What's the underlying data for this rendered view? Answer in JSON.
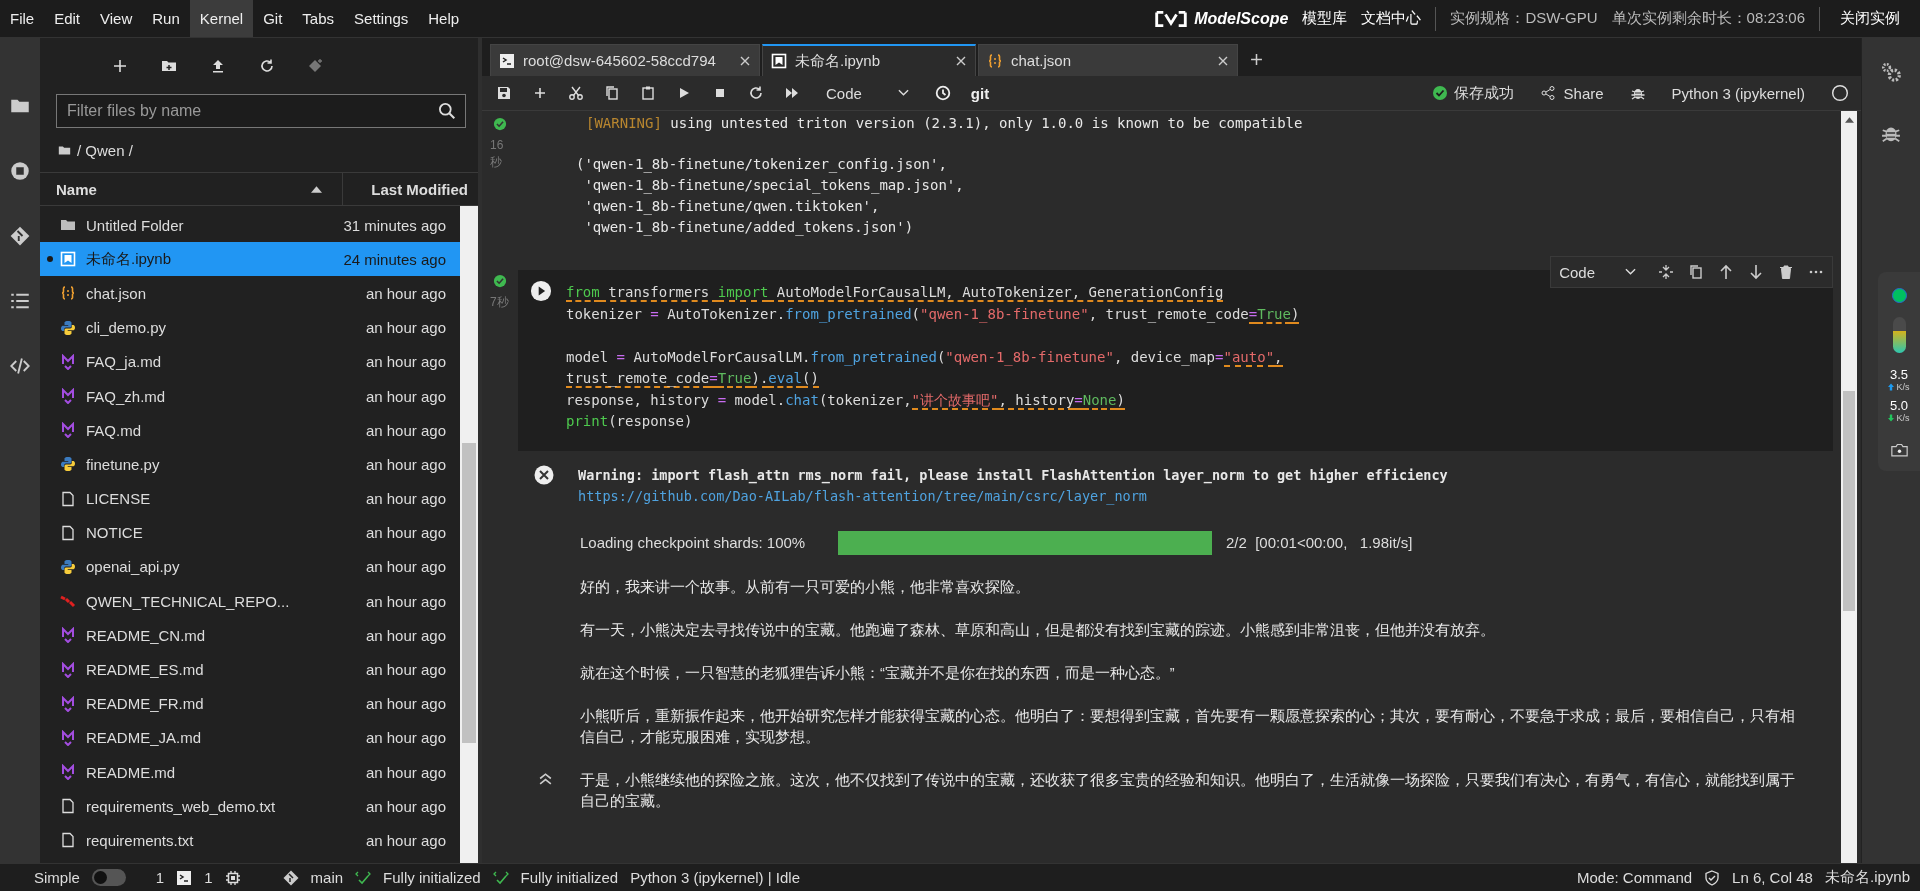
{
  "menu": [
    {
      "label": "File",
      "selected": false
    },
    {
      "label": "Edit",
      "selected": false
    },
    {
      "label": "View",
      "selected": false
    },
    {
      "label": "Run",
      "selected": false
    },
    {
      "label": "Kernel",
      "selected": true
    },
    {
      "label": "Git",
      "selected": false
    },
    {
      "label": "Tabs",
      "selected": false
    },
    {
      "label": "Settings",
      "selected": false
    },
    {
      "label": "Help",
      "selected": false
    }
  ],
  "header": {
    "logo": "ModelScope",
    "links": [
      "模型库",
      "文档中心"
    ],
    "spec": "实例规格：DSW-GPU",
    "remaining": "单次实例剩余时长：08:23:06",
    "close_button": "关闭实例"
  },
  "file_browser": {
    "filter_placeholder": "Filter files by name",
    "breadcrumb": "/ Qwen /",
    "columns": [
      "Name",
      "Last Modified"
    ],
    "files": [
      {
        "kind": "folder",
        "name": "Untitled Folder",
        "modified": "31 minutes ago",
        "selected": false,
        "running": false
      },
      {
        "kind": "notebook",
        "name": "未命名.ipynb",
        "modified": "24 minutes ago",
        "selected": true,
        "running": true
      },
      {
        "kind": "json",
        "name": "chat.json",
        "modified": "an hour ago",
        "selected": false,
        "running": false
      },
      {
        "kind": "python",
        "name": "cli_demo.py",
        "modified": "an hour ago",
        "selected": false,
        "running": false
      },
      {
        "kind": "markdown",
        "name": "FAQ_ja.md",
        "modified": "an hour ago",
        "selected": false,
        "running": false
      },
      {
        "kind": "markdown",
        "name": "FAQ_zh.md",
        "modified": "an hour ago",
        "selected": false,
        "running": false
      },
      {
        "kind": "markdown",
        "name": "FAQ.md",
        "modified": "an hour ago",
        "selected": false,
        "running": false
      },
      {
        "kind": "python",
        "name": "finetune.py",
        "modified": "an hour ago",
        "selected": false,
        "running": false
      },
      {
        "kind": "file",
        "name": "LICENSE",
        "modified": "an hour ago",
        "selected": false,
        "running": false
      },
      {
        "kind": "file",
        "name": "NOTICE",
        "modified": "an hour ago",
        "selected": false,
        "running": false
      },
      {
        "kind": "python",
        "name": "openai_api.py",
        "modified": "an hour ago",
        "selected": false,
        "running": false
      },
      {
        "kind": "pdf",
        "name": "QWEN_TECHNICAL_REPO...",
        "modified": "an hour ago",
        "selected": false,
        "running": false
      },
      {
        "kind": "markdown",
        "name": "README_CN.md",
        "modified": "an hour ago",
        "selected": false,
        "running": false
      },
      {
        "kind": "markdown",
        "name": "README_ES.md",
        "modified": "an hour ago",
        "selected": false,
        "running": false
      },
      {
        "kind": "markdown",
        "name": "README_FR.md",
        "modified": "an hour ago",
        "selected": false,
        "running": false
      },
      {
        "kind": "markdown",
        "name": "README_JA.md",
        "modified": "an hour ago",
        "selected": false,
        "running": false
      },
      {
        "kind": "markdown",
        "name": "README.md",
        "modified": "an hour ago",
        "selected": false,
        "running": false
      },
      {
        "kind": "file",
        "name": "requirements_web_demo.txt",
        "modified": "an hour ago",
        "selected": false,
        "running": false
      },
      {
        "kind": "file",
        "name": "requirements.txt",
        "modified": "an hour ago",
        "selected": false,
        "running": false
      }
    ]
  },
  "tabs": [
    {
      "kind": "terminal",
      "label": "root@dsw-645602-58ccd794",
      "selected": false
    },
    {
      "kind": "notebook",
      "label": "未命名.ipynb",
      "selected": true
    },
    {
      "kind": "json",
      "label": "chat.json",
      "selected": false
    }
  ],
  "toolbar": {
    "cell_type": "Code",
    "git": "git",
    "save_status": "保存成功",
    "share": "Share",
    "kernel": "Python 3 (ipykernel)"
  },
  "cell_1": {
    "exec_time": "16秒",
    "warning_tag": "[WARNING]",
    "warning_text": "using untested triton version (2.3.1), only 1.0.0 is known to be compatible",
    "result": [
      "('qwen-1_8b-finetune/tokenizer_config.json',",
      " 'qwen-1_8b-finetune/special_tokens_map.json',",
      " 'qwen-1_8b-finetune/qwen.tiktoken',",
      " 'qwen-1_8b-finetune/added_tokens.json')"
    ]
  },
  "cell_2": {
    "exec_time": "7秒",
    "cell_type": "Code",
    "lines": [
      {
        "kind": "code",
        "tokens": [
          {
            "kind": "kw",
            "text": "from",
            "warn": true
          },
          {
            "kind": "p",
            "text": " transformers ",
            "warn": true
          },
          {
            "kind": "kw",
            "text": "import",
            "warn": true
          },
          {
            "kind": "p",
            "text": " AutoModelForCausalLM, AutoTokenizer, GenerationConfig",
            "warn": true
          }
        ]
      },
      {
        "kind": "code",
        "tokens": [
          {
            "kind": "p",
            "text": "tokenizer ",
            "warn": false
          },
          {
            "kind": "op",
            "text": "=",
            "warn": false
          },
          {
            "kind": "p",
            "text": " AutoTokenizer.",
            "warn": false
          },
          {
            "kind": "fn",
            "text": "from_pretrained",
            "warn": false
          },
          {
            "kind": "p",
            "text": "(",
            "warn": false
          },
          {
            "kind": "str",
            "text": "\"qwen-1_8b-finetune\"",
            "warn": false
          },
          {
            "kind": "p",
            "text": ", trust_remote_code",
            "warn": false
          },
          {
            "kind": "op",
            "text": "=",
            "warn": true
          },
          {
            "kind": "const",
            "text": "True",
            "warn": true
          },
          {
            "kind": "p",
            "text": ")",
            "warn": true
          }
        ]
      },
      {
        "kind": "blank"
      },
      {
        "kind": "code",
        "tokens": [
          {
            "kind": "p",
            "text": "model ",
            "warn": false
          },
          {
            "kind": "op",
            "text": "=",
            "warn": false
          },
          {
            "kind": "p",
            "text": " AutoModelForCausalLM.",
            "warn": false
          },
          {
            "kind": "fn",
            "text": "from_pretrained",
            "warn": false
          },
          {
            "kind": "p",
            "text": "(",
            "warn": false
          },
          {
            "kind": "str",
            "text": "\"qwen-1_8b-finetune\"",
            "warn": false
          },
          {
            "kind": "p",
            "text": ", device_map",
            "warn": false
          },
          {
            "kind": "op",
            "text": "=",
            "warn": false
          },
          {
            "kind": "str",
            "text": "\"auto\"",
            "warn": true
          },
          {
            "kind": "p",
            "text": ",",
            "warn": true
          }
        ]
      },
      {
        "kind": "code",
        "tokens": [
          {
            "kind": "p",
            "text": "trust_remote_code",
            "warn": true
          },
          {
            "kind": "op",
            "text": "=",
            "warn": true
          },
          {
            "kind": "const",
            "text": "True",
            "warn": true
          },
          {
            "kind": "p",
            "text": ").",
            "warn": true
          },
          {
            "kind": "fn",
            "text": "eval",
            "warn": true
          },
          {
            "kind": "p",
            "text": "()",
            "warn": true
          }
        ]
      },
      {
        "kind": "code",
        "tokens": [
          {
            "kind": "p",
            "text": "response, history ",
            "warn": false
          },
          {
            "kind": "op",
            "text": "=",
            "warn": false
          },
          {
            "kind": "p",
            "text": " model.",
            "warn": false
          },
          {
            "kind": "fn",
            "text": "chat",
            "warn": false
          },
          {
            "kind": "p",
            "text": "(tokenizer,",
            "warn": false
          },
          {
            "kind": "str",
            "text": "\"讲个故事吧\"",
            "warn": true
          },
          {
            "kind": "p",
            "text": ", history",
            "warn": true
          },
          {
            "kind": "op",
            "text": "=",
            "warn": true
          },
          {
            "kind": "const",
            "text": "None",
            "warn": true
          },
          {
            "kind": "p",
            "text": ")",
            "warn": true
          }
        ]
      },
      {
        "kind": "code",
        "tokens": [
          {
            "kind": "builtin",
            "text": "print",
            "warn": false
          },
          {
            "kind": "p",
            "text": "(response)",
            "warn": false
          }
        ]
      }
    ],
    "stderr": "Warning: import flash_attn rms_norm fail, please install FlashAttention layer_norm to get higher efficiency",
    "stderr_link": "https://github.com/Dao-AILab/flash-attention/tree/main/csrc/layer_norm",
    "progress": {
      "label": "Loading checkpoint shards: 100%",
      "level": 1,
      "stats": "2/2  [00:01<00:00,   1.98it/s]"
    },
    "story": [
      "好的，我来讲一个故事。从前有一只可爱的小熊，他非常喜欢探险。",
      "有一天，小熊决定去寻找传说中的宝藏。他跑遍了森林、草原和高山，但是都没有找到宝藏的踪迹。小熊感到非常沮丧，但他并没有放弃。",
      "就在这个时候，一只智慧的老狐狸告诉小熊：“宝藏并不是你在找的东西，而是一种心态。”",
      "小熊听后，重新振作起来，他开始研究怎样才能获得宝藏的心态。他明白了：要想得到宝藏，首先要有一颗愿意探索的心；其次，要有耐心，不要急于求成；最后，要相信自己，只有相信自己，才能克服困难，实现梦想。",
      "于是，小熊继续他的探险之旅。这次，他不仅找到了传说中的宝藏，还收获了很多宝贵的经验和知识。他明白了，生活就像一场探险，只要我们有决心，有勇气，有信心，就能找到属于自己的宝藏。"
    ]
  },
  "monitor": {
    "memory": {
      "level": 0.6
    },
    "upload": "3.5",
    "upload_unit": "K/s",
    "download": "5.0",
    "download_unit": "K/s"
  },
  "status_bar": {
    "mode_label": "Simple",
    "simple_on": false,
    "terminals": "1",
    "kernels": "1",
    "branch": "main",
    "git_status": "Fully initialized",
    "lsp_status": "Fully initialized",
    "kernel_status": "Python 3 (ipykernel) | Idle",
    "mode": "Mode: Command",
    "cursor": "Ln 6, Col 48",
    "file": "未命名.ipynb"
  }
}
